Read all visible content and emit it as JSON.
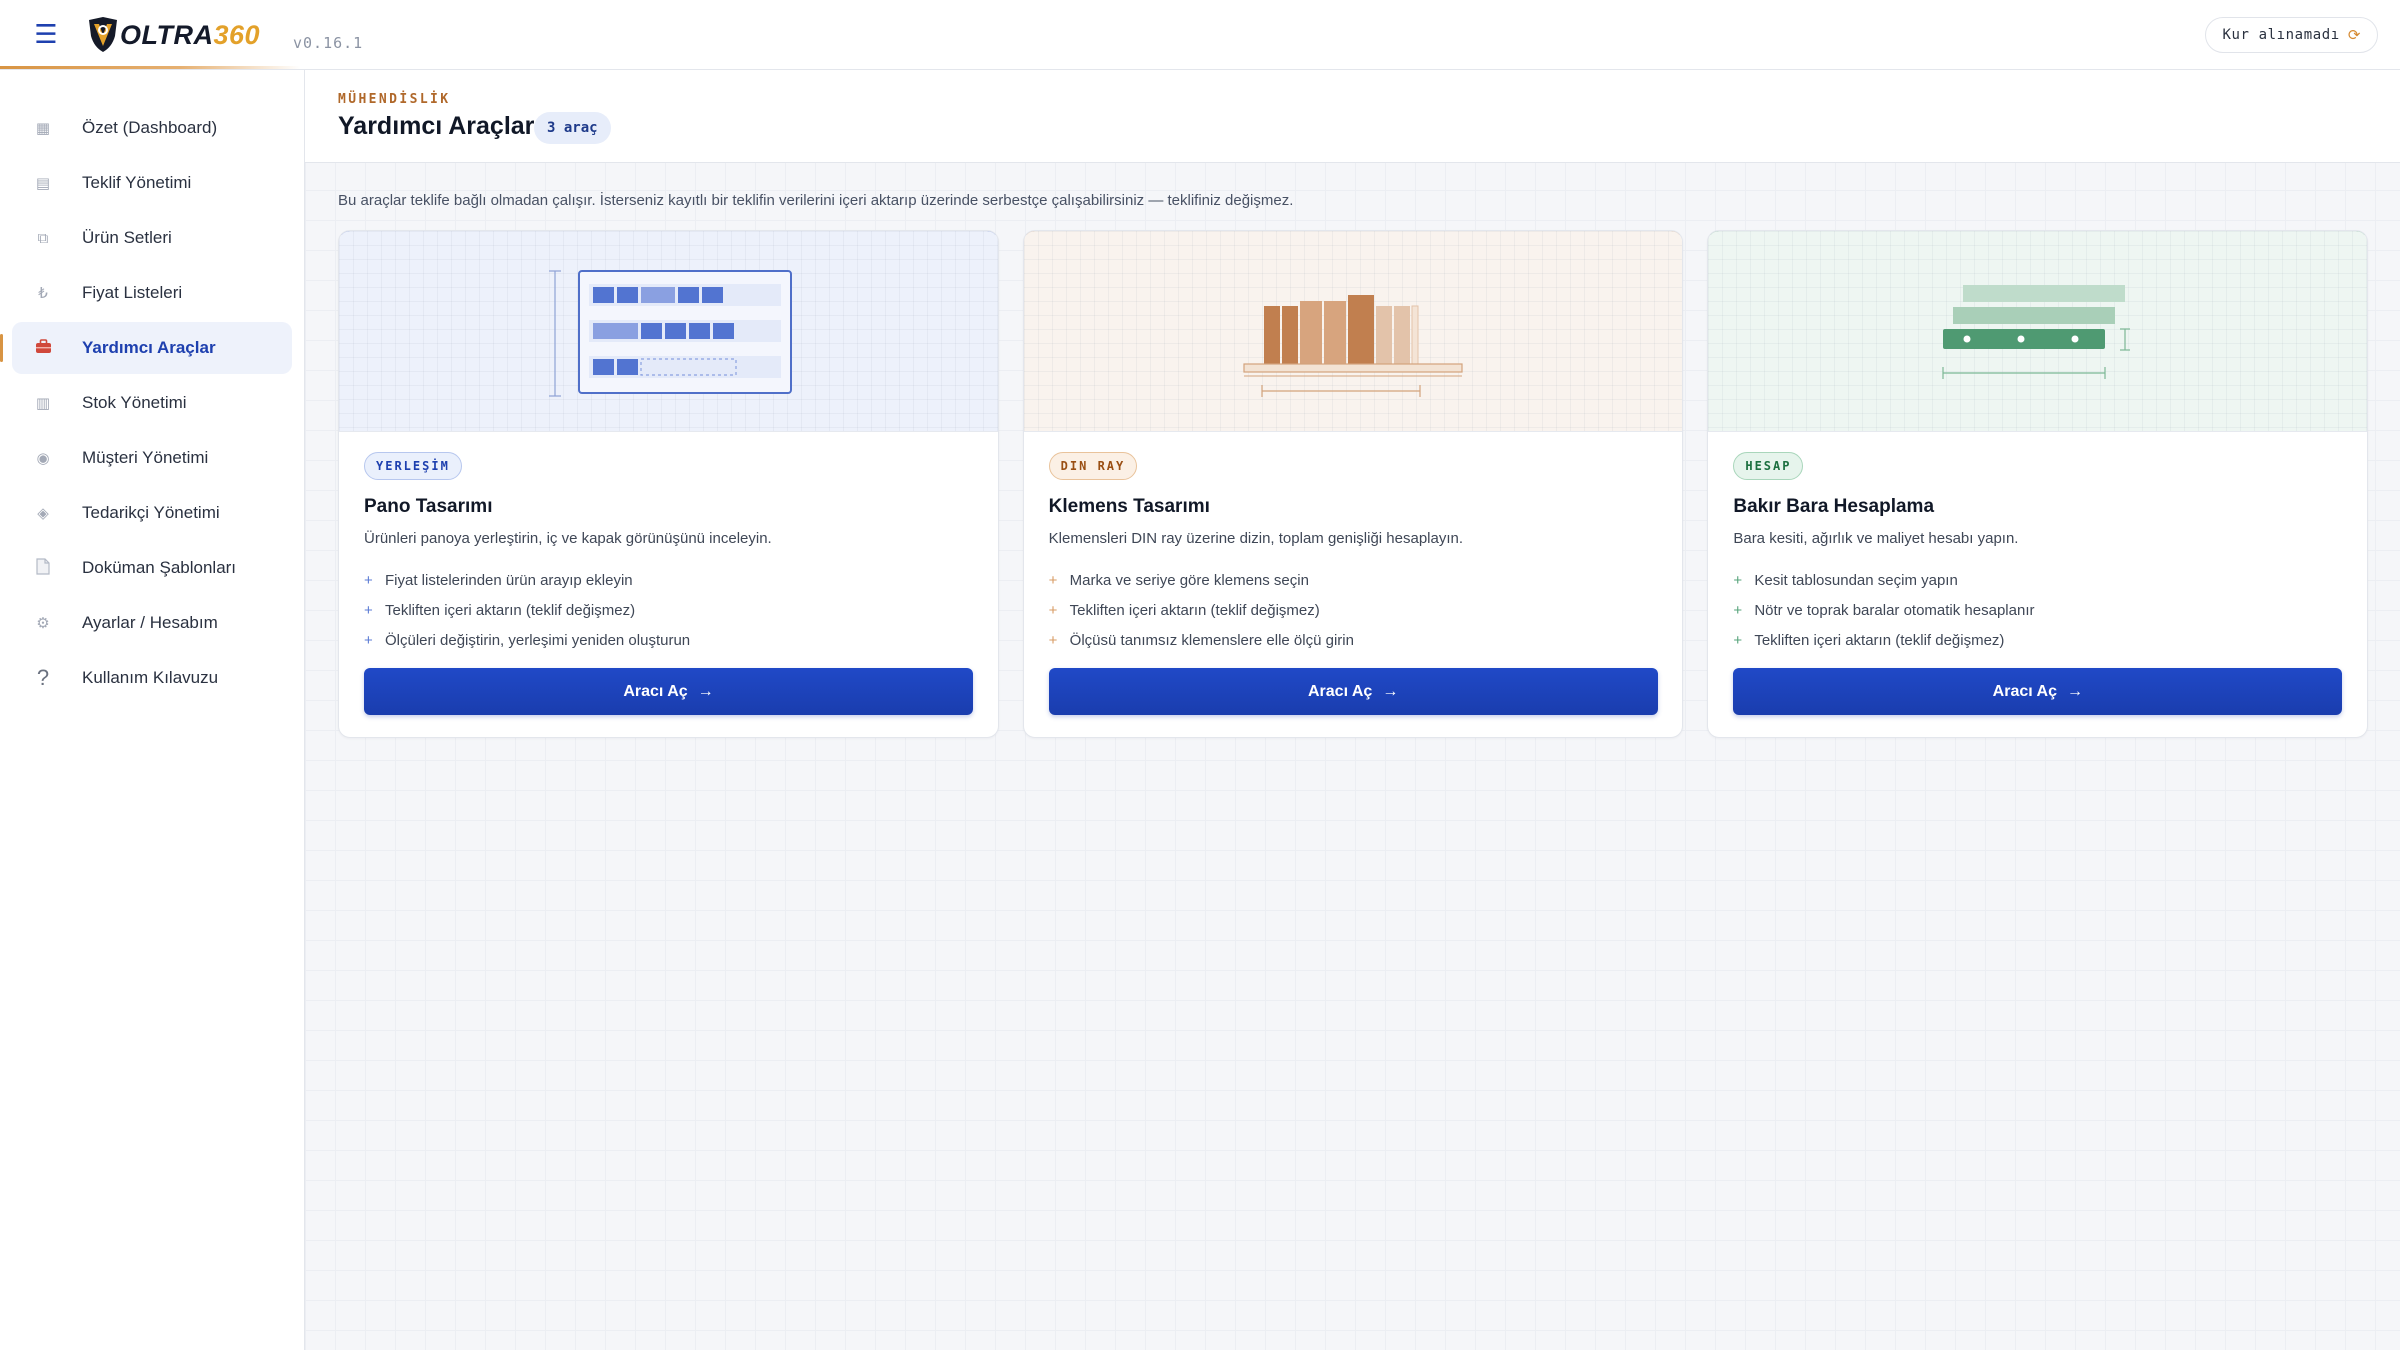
{
  "header": {
    "logo_text": "OLTRA",
    "logo_number": "360",
    "version": "v0.16.1",
    "rate_status": "Kur alınamadı",
    "icons": {
      "menu": "hamburger-menu-icon",
      "refresh": "refresh-icon"
    }
  },
  "sidebar": {
    "items": [
      {
        "label": "Özet (Dashboard)",
        "icon": "dashboard-icon",
        "glyph": "▦"
      },
      {
        "label": "Teklif Yönetimi",
        "icon": "document-list-icon",
        "glyph": "▤"
      },
      {
        "label": "Ürün Setleri",
        "icon": "stack-icon",
        "glyph": "⧉"
      },
      {
        "label": "Fiyat Listeleri",
        "icon": "lira-icon",
        "glyph": "₺"
      },
      {
        "label": "Yardımcı Araçlar",
        "icon": "toolbox-icon",
        "glyph": "▬",
        "active": true
      },
      {
        "label": "Stok Yönetimi",
        "icon": "inventory-icon",
        "glyph": "▥"
      },
      {
        "label": "Müşteri Yönetimi",
        "icon": "customer-icon",
        "glyph": "◉"
      },
      {
        "label": "Tedarikçi Yönetimi",
        "icon": "supplier-icon",
        "glyph": "◈"
      },
      {
        "label": "Doküman Şablonları",
        "icon": "file-icon",
        "glyph": "▯"
      },
      {
        "label": "Ayarlar / Hesabım",
        "icon": "gear-icon",
        "glyph": "⚙"
      },
      {
        "label": "Kullanım Kılavuzu",
        "icon": "help-icon",
        "glyph": "?"
      }
    ]
  },
  "page": {
    "eyebrow": "MÜHENDİSLİK",
    "title": "Yardımcı Araçlar",
    "count_badge": "3 araç",
    "intro": "Bu araçlar teklife bağlı olmadan çalışır. İsterseniz kayıtlı bir teklifin verilerini içeri aktarıp üzerinde serbestçe çalışabilirsiniz — teklifiniz değişmez."
  },
  "cards": [
    {
      "tag": "YERLEŞİM",
      "title": "Pano Tasarımı",
      "description": "Ürünleri panoya yerleştirin, iç ve kapak görünüşünü inceleyin.",
      "features": [
        "Fiyat listelerinden ürün arayıp ekleyin",
        "Tekliften içeri aktarın (teklif değişmez)",
        "Ölçüleri değiştirin, yerleşimi yeniden oluşturun"
      ],
      "button": "Aracı Aç",
      "accent": "#2b4fc0"
    },
    {
      "tag": "DIN RAY",
      "title": "Klemens Tasarımı",
      "description": "Klemensleri DIN ray üzerine dizin, toplam genişliği hesaplayın.",
      "features": [
        "Marka ve seriye göre klemens seçin",
        "Tekliften içeri aktarın (teklif değişmez)",
        "Ölçüsü tanımsız klemenslere elle ölçü girin"
      ],
      "button": "Aracı Aç",
      "accent": "#b97a4a"
    },
    {
      "tag": "HESAP",
      "title": "Bakır Bara Hesaplama",
      "description": "Bara kesiti, ağırlık ve maliyet hesabı yapın.",
      "features": [
        "Kesit tablosundan seçim yapın",
        "Nötr ve toprak baralar otomatik hesaplanır",
        "Tekliften içeri aktarın (teklif değişmez)"
      ],
      "button": "Aracı Aç",
      "accent": "#2f8a58"
    }
  ],
  "symbols": {
    "plus": "+",
    "arrow": "→"
  }
}
